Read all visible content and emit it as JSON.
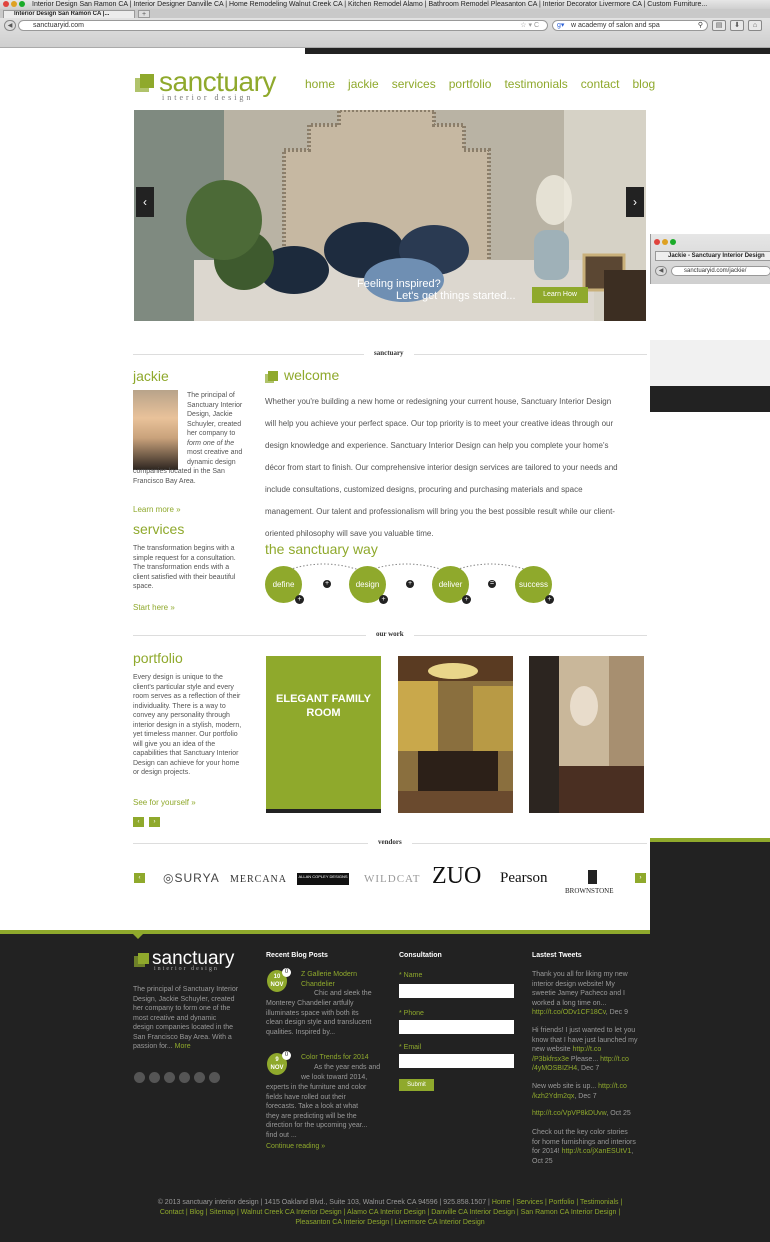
{
  "browser": {
    "window_title": "Interior Design San Ramon CA | Interior Designer Danville CA | Home Remodeling Walnut Creek CA | Kitchen Remodel Alamo | Bathroom Remodel Pleasanton CA | Interior Decorator Livermore CA | Custom Furniture...",
    "tab_title": "Interior Design San Ramon CA |...",
    "tab_new": "+",
    "url": "sanctuaryid.com",
    "search_text": "w academy of salon and spa",
    "second_window": {
      "tab_title": "Jackie - Sanctuary Interior Design",
      "url": "sanctuaryid.com/jackie/"
    },
    "icons": [
      "back-icon",
      "star-icon",
      "reload-icon",
      "search-icon",
      "download-icon",
      "home-icon"
    ]
  },
  "header": {
    "logo_text": "sanctuary",
    "logo_sub": "interior design",
    "nav": [
      "home",
      "jackie",
      "services",
      "portfolio",
      "testimonials",
      "contact",
      "blog"
    ]
  },
  "hero": {
    "line1": "Feeling inspired?",
    "line2": "Let's get things started...",
    "button": "Learn How",
    "prev": "‹",
    "next": "›"
  },
  "section_labels": {
    "sanctuary": "sanctuary",
    "our_work": "our work",
    "vendors": "vendors"
  },
  "jackie": {
    "title": "jackie",
    "bio": "The principal of Sanctuary Interior Design, Jackie Schuyler, created her company to form one of the most creative and dynamic design companies located in the San Francisco Bay Area.",
    "bio_lines": [
      "The principal of",
      "Sanctuary Interior",
      "Design, Jackie",
      "Schuyler, created",
      "her company to",
      "form one of the",
      "most creative and",
      "dynamic design"
    ],
    "bio_tail": [
      "companies located in the San",
      "Francisco Bay Area."
    ],
    "link": "Learn more »"
  },
  "services": {
    "title": "services",
    "text_lines": [
      "The transformation begins with a",
      "simple request for a consultation.",
      "The transformation ends with a",
      "client satisfied with their beautiful",
      "space."
    ],
    "link": "Start here »"
  },
  "welcome": {
    "title": "welcome",
    "lines": [
      "Whether you're building a new home or redesigning your current house, Sanctuary Interior Design",
      "will help you achieve your perfect space. Our top priority is to meet your creative ideas through our",
      "design knowledge and experience. Sanctuary Interior Design can help you complete your home's",
      "décor from start to finish. Our comprehensive interior design services are tailored to your needs and",
      "include consultations, customized designs, procuring and purchasing materials and space",
      "management. Our talent and professionalism will bring you the best possible result while our client-",
      "oriented philosophy will save you valuable time."
    ]
  },
  "way": {
    "title": "the sanctuary way",
    "steps": [
      "define",
      "design",
      "deliver",
      "success"
    ],
    "connectors": [
      "+",
      "+",
      "="
    ]
  },
  "portfolio": {
    "title": "portfolio",
    "text_lines": [
      "Every design is unique to the",
      "client's particular style and every",
      "room serves as a reflection of their",
      "individuality. There is a way to",
      "convey any personality through",
      "interior design in a stylish, modern,",
      "yet timeless manner. Our portfolio",
      "will give you an idea of the",
      "capabilities that Sanctuary Interior",
      "Design can achieve for your home",
      "or design projects."
    ],
    "link": "See for yourself »",
    "feature_line1": "ELEGANT FAMILY",
    "feature_line2": "ROOM",
    "prev": "‹",
    "next": "›"
  },
  "vendors": {
    "items": [
      "SURYA",
      "MERCANA",
      "ALLAN COPLEY DESIGNS",
      "WILDCAT",
      "ZUO",
      "Pearson",
      "BROWNSTONE"
    ],
    "prev": "‹",
    "next": "›"
  },
  "footer": {
    "logo_text": "sanctuary",
    "logo_sub": "interior design",
    "about_lines": [
      "The principal of Sanctuary Interior",
      "Design, Jackie Schuyler, created",
      "her company to form one of the",
      "most creative and dynamic",
      "design companies located in the",
      "San Francisco Bay Area. With a"
    ],
    "about_last": "passion for...",
    "about_more": "More",
    "blog": {
      "title": "Recent Blog Posts",
      "posts": [
        {
          "day": "10",
          "month": "NOV",
          "comments": "0",
          "title_lines": [
            "Z Gallerie Modern",
            "Chandelier"
          ],
          "lead": "Chic and sleek the",
          "body_lines": [
            "Monterey Chandelier artfully",
            "illuminates space with both its",
            "clean design style and translucent",
            "qualities. Inspired by..."
          ]
        },
        {
          "day": "9",
          "month": "NOV",
          "comments": "0",
          "title_lines": [
            "Color Trends for 2014"
          ],
          "lead": "As the year ends and",
          "lead2": "we look toward 2014,",
          "body_lines": [
            "experts in the furniture and color",
            "fields have rolled out their",
            "forecasts. Take a look at what",
            "they are predicting will be the",
            "direction for the upcoming year...",
            "find out ..."
          ]
        }
      ],
      "continue": "Continue reading »"
    },
    "consultation": {
      "title": "Consultation",
      "name_label": "* Name",
      "phone_label": "* Phone",
      "email_label": "* Email",
      "submit": "Submit"
    },
    "tweets": {
      "title": "Lastest Tweets",
      "items": [
        {
          "lines": [
            "Thank you all for liking my new",
            "interior design website! My",
            "sweetie Jamey Pacheco and I",
            "worked a long time on..."
          ],
          "link": "http://t.co/ODv1CF18Cv",
          "date": ", Dec 9"
        },
        {
          "lines": [
            "Hi friends! I just wanted to let you",
            "know that I have just launched my",
            "new website"
          ],
          "link_lines": [
            "http://t.co",
            "/P3bkfrsx3e",
            "/4yMOSBIZH4"
          ],
          "mid": " Please... ",
          "link2": "http://t.co",
          "date": ", Dec 7"
        },
        {
          "lines": [
            "New web site is up..."
          ],
          "link_lines": [
            "http://t.co",
            "/kzh2Ydm2qx"
          ],
          "date": ", Dec 7"
        },
        {
          "lines": [],
          "link": "http://t.co/VpVP8kDUvw",
          "date": ", Oct 25"
        },
        {
          "lines": [
            "Check out the key color stories",
            "for home furnishings and interiors",
            "for 2014!"
          ],
          "link": "http://t.co/jXanESUtV1",
          "date": ",",
          "date2": "Oct 25"
        }
      ]
    },
    "social_icons": [
      "facebook-icon",
      "twitter-icon",
      "linkedin-icon",
      "pinterest-icon",
      "houzz-icon",
      "rss-icon"
    ]
  },
  "copyright": {
    "line1_plain": "© 2013 sanctuary interior design | 1415 Oakland Blvd., Suite 103, Walnut Creek CA 94596 | 925.858.1507 | ",
    "line1_links": "Home | Services | Portfolio | Testimonials |",
    "line2": "Contact | Blog | Sitemap | Walnut Creek CA Interior Design | Alamo CA Interior Design | Danville CA Interior Design | San Ramon CA Interior Design |",
    "line3": "Pleasanton CA Interior Design | Livermore CA Interior Design"
  },
  "colors": {
    "brand_green": "#8fa92c",
    "footer_bg": "#222222"
  }
}
